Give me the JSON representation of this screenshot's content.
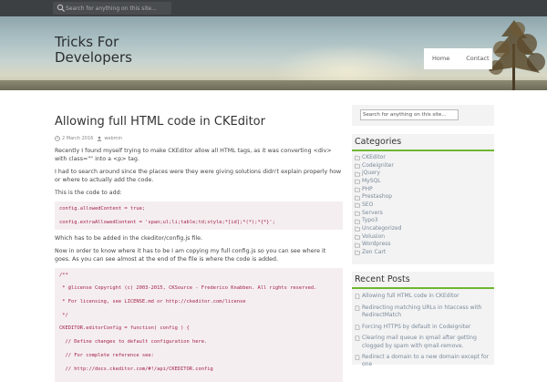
{
  "topbar": {
    "search_placeholder": "Search for anything on this site..."
  },
  "header": {
    "site_title": "Tricks For Developers",
    "nav": [
      "Home",
      "Contact"
    ]
  },
  "post": {
    "title": "Allowing full HTML code in CKEditor",
    "date": "2 March 2016",
    "author": "webmin",
    "intro": "Recently I found myself trying to make CKEditor allow all HTML tags, as it was converting <div> with class=\"\" into a <p> tag.",
    "para2": "I had to search around since the places were they were giving solutions didn't explain properly how or where to actually add the code.",
    "para3": "This is the code to add:",
    "code1": [
      "config.allowedContent = true;",
      "config.extraAllowedContent = 'span;ul;li;table;td;style;*[id];*(*);*{*}';"
    ],
    "para4": "Which has to be added in the ckeditor/config.js file.",
    "para5": "Now in order to know where it has to be I am copying my full config.js so you can see where it goes. As you can see almost at the end of the file is where the code is added.",
    "code2": [
      "/**",
      " * @license Copyright (c) 2003-2015, CKSource - Frederico Knabben. All rights reserved.",
      " * For licensing, see LICENSE.md or http://ckeditor.com/license",
      " */",
      "CKEDITOR.editorConfig = function( config ) {",
      "  // Define changes to default configuration here.",
      "  // For complete reference see:",
      "  // http://docs.ckeditor.com/#!/api/CKEDITOR.config"
    ]
  },
  "sidebar": {
    "search_placeholder": "Search for anything on this site...",
    "categories_title": "Categories",
    "categories": [
      "CKEditor",
      "Codeigniter",
      "jQuery",
      "MySQL",
      "PHP",
      "Prestashop",
      "SEO",
      "Servers",
      "Typo3",
      "Uncategorized",
      "Volusion",
      "Wordpress",
      "Zen Cart"
    ],
    "recent_title": "Recent Posts",
    "recent": [
      "Allowing full HTML code in CKEditor",
      "Redirecting matching URLs in htaccess with RedirectMatch",
      "Forcing HTTPS by default in Codeigniter",
      "Clearing mail queue in qmail after getting clogged by spam with qmail-remove.",
      "Redirect a domain to a new domain except for one"
    ]
  },
  "colors": {
    "accent_green": "#6fb630",
    "link_gray": "#7a8a9a",
    "code_pink": "#a3234a"
  }
}
